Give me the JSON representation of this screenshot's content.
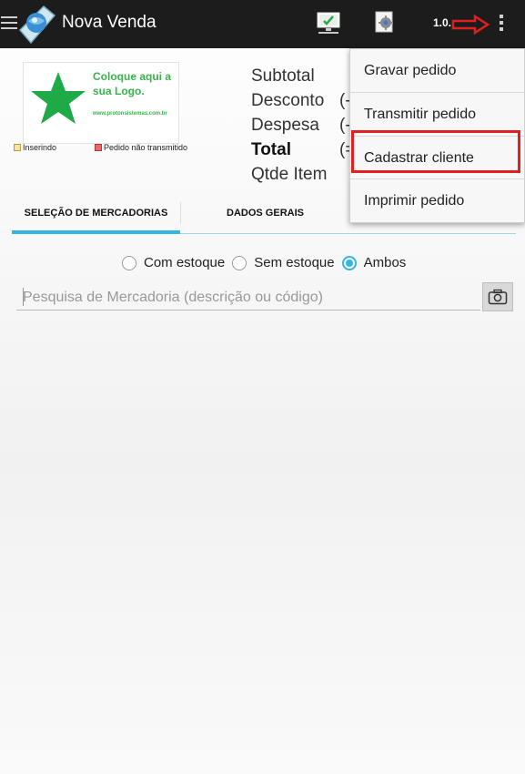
{
  "appbar": {
    "title": "Nova Venda",
    "version": "1.0.",
    "icons": [
      "menu-icon",
      "app-logo-icon",
      "sync-monitor-icon",
      "settings-document-icon",
      "overflow-menu-icon",
      "red-arrow-annotation"
    ]
  },
  "logo": {
    "line1": "Coloque aqui a",
    "line2": "sua Logo.",
    "url": "www.protonsistemas.com.br"
  },
  "status": {
    "inserting": "Inserindo",
    "not_transmitted": "Pedido não transmitido"
  },
  "totals": {
    "subtotal_label": "Subtotal",
    "discount_label": "Desconto",
    "discount_value": "(-",
    "expense_label": "Despesa",
    "expense_value": "(-",
    "total_label": "Total",
    "total_value": "(=",
    "qty_label": "Qtde Item"
  },
  "tabs": [
    {
      "label": "SELEÇÃO DE MERCADORIAS",
      "active": true
    },
    {
      "label": "DADOS GERAIS",
      "active": false
    }
  ],
  "stock_filter": {
    "options": [
      "Com estoque",
      "Sem estoque",
      "Ambos"
    ],
    "selected": "Ambos"
  },
  "search": {
    "placeholder": "Pesquisa de Mercadoria (descrição ou código)",
    "value": ""
  },
  "menu": {
    "items": [
      "Gravar pedido",
      "Transmitir pedido",
      "Cadastrar cliente",
      "Imprimir pedido"
    ],
    "highlighted": "Cadastrar cliente"
  },
  "colors": {
    "accent": "#33b5e5",
    "appbar": "#1c1c1c",
    "logo_green": "#37b54a",
    "highlight_red": "#e02020"
  }
}
